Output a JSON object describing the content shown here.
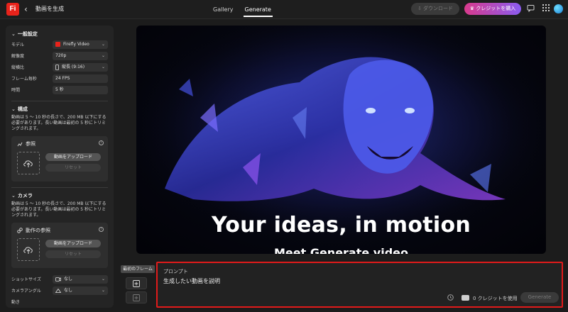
{
  "app": {
    "logo": "Fi",
    "page_title": "動画を生成",
    "back_glyph": "‹"
  },
  "tabs": [
    {
      "label": "Gallery"
    },
    {
      "label": "Generate"
    }
  ],
  "header": {
    "download_label": "⇩ ダウンロード",
    "buy_label": "♛ クレジットを購入"
  },
  "settings": {
    "general_title": "一般設定",
    "model_label": "モデル",
    "model_value": "Firefly Video",
    "resolution_label": "解像度",
    "resolution_value": "720p",
    "aspect_label": "縦横比",
    "aspect_value": "縦長 (9:16)",
    "fps_label": "フレーム毎秒",
    "fps_value": "24 FPS",
    "duration_label": "時間",
    "duration_value": "5 秒",
    "composition_title": "構成",
    "composition_desc": "動画は 5 〜 10 秒の長さで、200 MB 以下にする必要があります。長い動画は最初の 5 秒にトリミングされます。",
    "reference_title": "参照",
    "upload_label": "動画をアップロード",
    "reset_label": "リセット",
    "camera_title": "カメラ",
    "camera_desc": "動画は 5 〜 10 秒の長さで、200 MB 以下にする必要があります。長い動画は最初の 5 秒にトリミングされます。",
    "motion_ref_title": "動作の参照",
    "shot_size_label": "ショットサイズ",
    "shot_size_value": "なし",
    "camera_angle_label": "カメラアングル",
    "camera_angle_value": "なし",
    "motion_label": "動き"
  },
  "hero": {
    "title": "Your ideas, in motion",
    "subtitle": "Meet Generate video"
  },
  "frames": {
    "tooltip": "最初のフレーム"
  },
  "prompt": {
    "label": "プロンプト",
    "placeholder": "生成したい動画を説明",
    "credits": "0 クレジットを使用",
    "generate_label": "Generate"
  }
}
